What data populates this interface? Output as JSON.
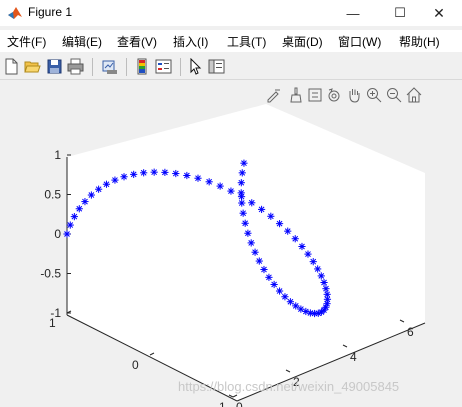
{
  "window": {
    "title": "Figure 1"
  },
  "window_controls": {
    "minimize": "—",
    "maximize": "☐",
    "close": "✕"
  },
  "menu": [
    "文件(F)",
    "编辑(E)",
    "查看(V)",
    "插入(I)",
    "工具(T)",
    "桌面(D)",
    "窗口(W)",
    "帮助(H)"
  ],
  "toolbar_icons": [
    "new-figure-icon",
    "open-file-icon",
    "save-icon",
    "print-icon",
    "link-plot-icon",
    "insert-colorbar-icon",
    "insert-legend-icon",
    "edit-plot-arrow-icon",
    "property-inspector-icon"
  ],
  "axes_toolbar_icons": [
    "edit-icon",
    "brush-icon",
    "data-tips-icon",
    "rotate-3d-icon",
    "pan-icon",
    "zoom-in-icon",
    "zoom-out-icon",
    "home-icon"
  ],
  "watermark": "https://blog.csdn.net/weixin_49005845",
  "colors": {
    "marker": "#0000ff",
    "axes_bg": "#ffffff",
    "figure_bg": "#f0f0f0"
  },
  "chart_data": {
    "type": "scatter",
    "title": "",
    "xlabel": "",
    "ylabel": "",
    "zlabel": "",
    "marker": "*",
    "x_ticks": [
      "0",
      "2",
      "4",
      "6"
    ],
    "y_ticks": [
      "-1",
      "0",
      "1"
    ],
    "z_ticks": [
      "-1",
      "-0.5",
      "0",
      "0.5",
      "1"
    ],
    "xlim": [
      0,
      6.283
    ],
    "ylim": [
      -1,
      1
    ],
    "zlim": [
      -1,
      1
    ],
    "series": [
      {
        "x": [
          0,
          0.1,
          0.2,
          0.3,
          0.4,
          0.5,
          0.6,
          0.7,
          0.8,
          0.9,
          1.0,
          1.1,
          1.2,
          1.3,
          1.4,
          1.5,
          1.6,
          1.7,
          1.8,
          1.9,
          2.0,
          2.1,
          2.2,
          2.3,
          2.4,
          2.5,
          2.6,
          2.7,
          2.8,
          2.9,
          3.0,
          3.1,
          3.2,
          3.3,
          3.4,
          3.5,
          3.6,
          3.7,
          3.8,
          3.9,
          4.0,
          4.1,
          4.2,
          4.3,
          4.4,
          4.5,
          4.6,
          4.7,
          4.8,
          4.9,
          5.0,
          5.1,
          5.2,
          5.3,
          5.4,
          5.5,
          5.6,
          5.7,
          5.8,
          5.9,
          6.0,
          6.1,
          6.2
        ],
        "y": [
          1,
          0.995,
          0.98,
          0.955,
          0.921,
          0.878,
          0.825,
          0.765,
          0.697,
          0.622,
          0.54,
          0.454,
          0.362,
          0.267,
          0.17,
          0.071,
          -0.029,
          -0.129,
          -0.227,
          -0.323,
          -0.416,
          -0.505,
          -0.589,
          -0.666,
          -0.737,
          -0.801,
          -0.857,
          -0.904,
          -0.942,
          -0.971,
          -0.99,
          -0.999,
          -0.998,
          -0.987,
          -0.967,
          -0.936,
          -0.897,
          -0.848,
          -0.791,
          -0.726,
          -0.654,
          -0.575,
          -0.49,
          -0.401,
          -0.307,
          -0.211,
          -0.112,
          -0.012,
          0.087,
          0.187,
          0.284,
          0.378,
          0.469,
          0.554,
          0.635,
          0.709,
          0.776,
          0.835,
          0.886,
          0.927,
          0.96,
          0.983,
          0.997
        ],
        "z": [
          0,
          0.1,
          0.199,
          0.296,
          0.389,
          0.479,
          0.565,
          0.644,
          0.717,
          0.783,
          0.841,
          0.891,
          0.932,
          0.964,
          0.985,
          0.997,
          1.0,
          0.992,
          0.974,
          0.946,
          0.909,
          0.863,
          0.808,
          0.746,
          0.675,
          0.598,
          0.516,
          0.427,
          0.335,
          0.239,
          0.141,
          0.042,
          -0.058,
          -0.158,
          -0.256,
          -0.351,
          -0.443,
          -0.53,
          -0.612,
          -0.688,
          -0.757,
          -0.818,
          -0.872,
          -0.916,
          -0.952,
          -0.978,
          -0.994,
          -1.0,
          -0.996,
          -0.982,
          -0.959,
          -0.926,
          -0.883,
          -0.832,
          -0.773,
          -0.706,
          -0.631,
          -0.551,
          -0.465,
          -0.374,
          -0.279,
          -0.182,
          -0.083
        ]
      }
    ]
  }
}
